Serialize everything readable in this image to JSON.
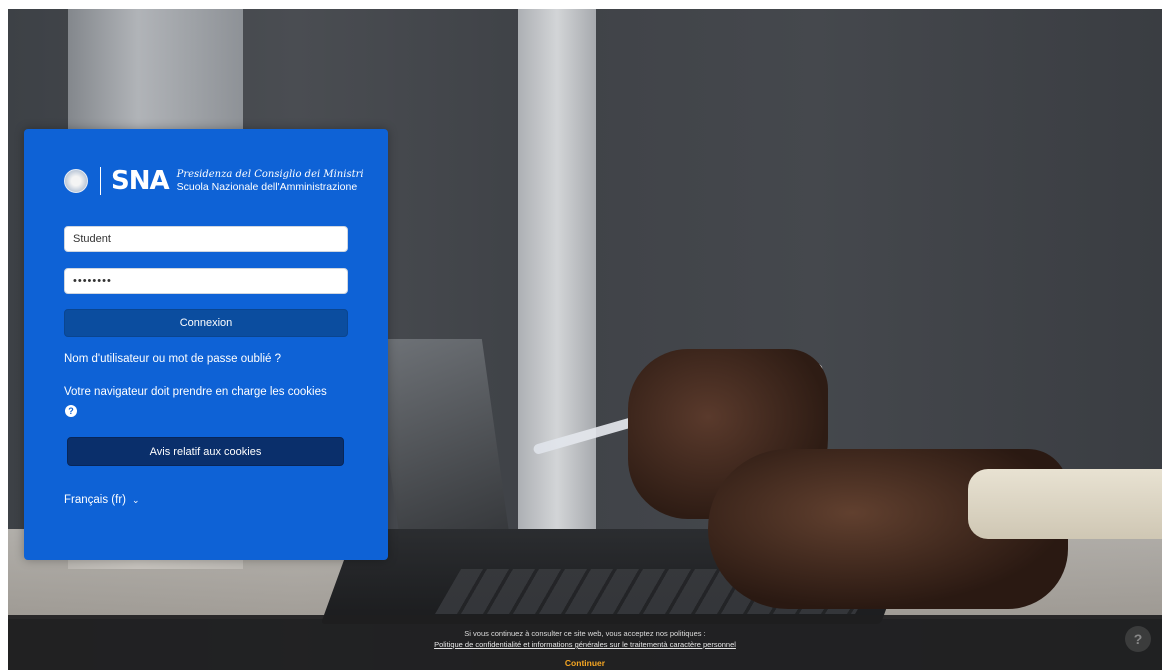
{
  "logo": {
    "abbr": "SNA",
    "institution_script": "Presidenza del Consiglio dei Ministri",
    "school": "Scuola Nazionale dell'Amministrazione",
    "emblem_icon": "italian-republic-emblem-icon"
  },
  "login": {
    "username_value": "Student",
    "password_value": "••••••••",
    "submit_label": "Connexion",
    "forgot_link": "Nom d'utilisateur ou mot de passe oublié ?",
    "cookies_notice": "Votre navigateur doit prendre en charge les cookies",
    "help_icon_glyph": "?",
    "cookies_button": "Avis relatif aux cookies"
  },
  "language": {
    "selected": "Français (fr)",
    "chevron": "⌄"
  },
  "cookie_banner": {
    "line1": "Si vous continuez à consulter ce site web, vous acceptez nos politiques :",
    "policy_link": "Politique de confidentialité et informations générales sur le traitementà caractère personnel",
    "continue_label": "Continuer",
    "help_glyph": "?"
  },
  "colors": {
    "panel": "#0e62d6",
    "login_button": "#0b4d9f",
    "cookies_button": "#0a2f6b",
    "continue": "#f5a623"
  }
}
